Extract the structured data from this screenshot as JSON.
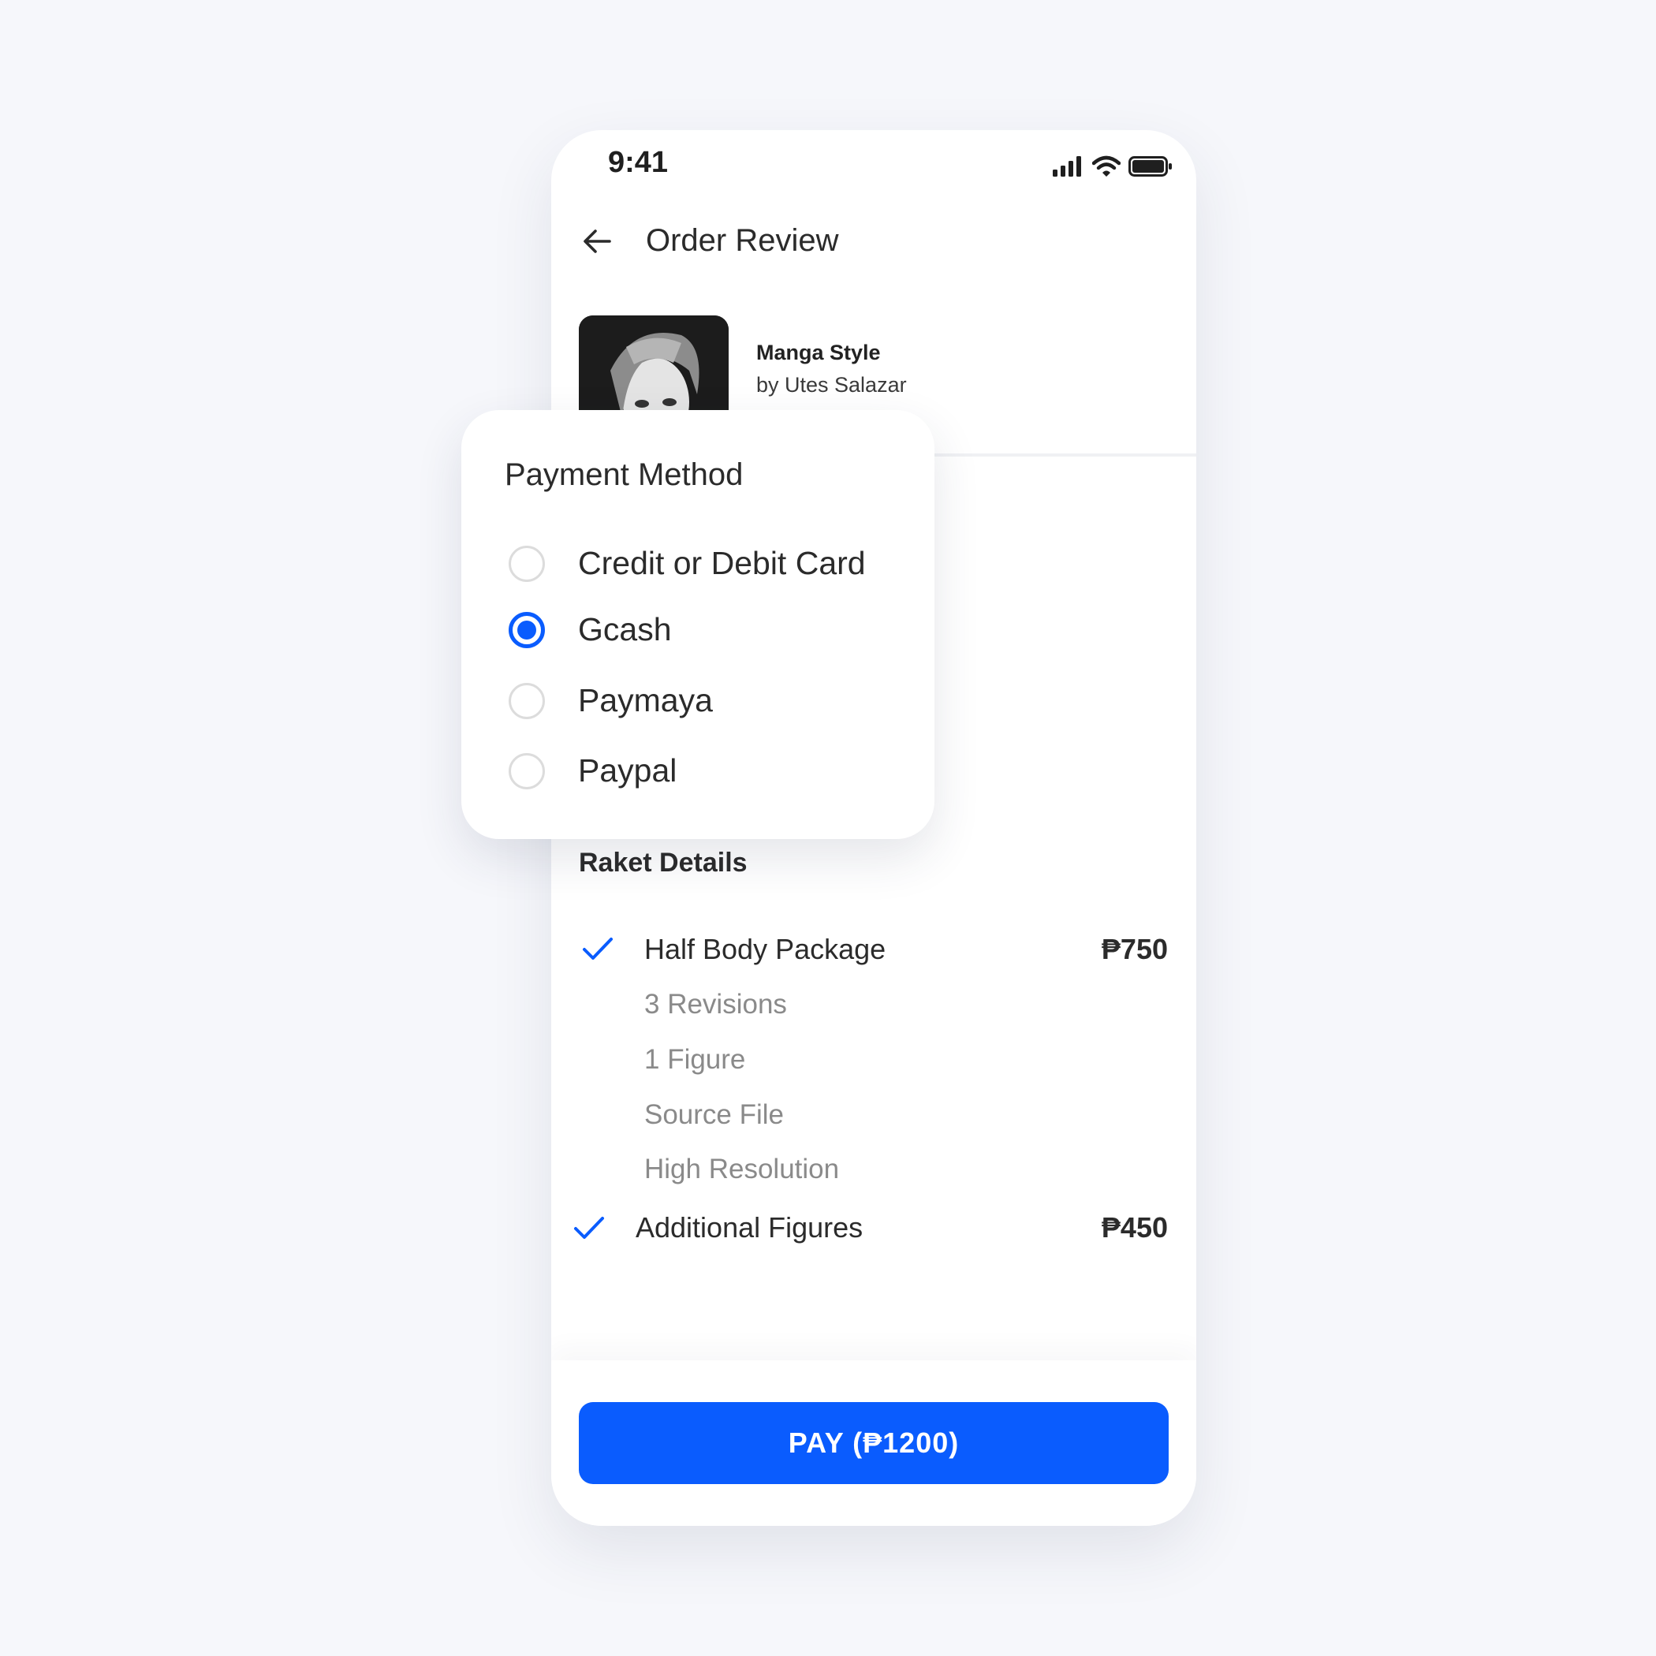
{
  "status_bar": {
    "time": "9:41"
  },
  "header": {
    "title": "Order Review"
  },
  "product": {
    "name": "Manga Style",
    "artist": "by Utes Salazar"
  },
  "payment": {
    "title": "Payment Method",
    "options": [
      {
        "label": "Credit or Debit Card",
        "selected": false
      },
      {
        "label": "Gcash",
        "selected": true
      },
      {
        "label": "Paymaya",
        "selected": false
      },
      {
        "label": "Paypal",
        "selected": false
      }
    ]
  },
  "details": {
    "title": "Raket Details",
    "package": {
      "label": "Half Body Package",
      "price": "₱750",
      "features": [
        "3 Revisions",
        "1 Figure",
        "Source File",
        "High Resolution"
      ]
    },
    "addon": {
      "label": "Additional Figures",
      "price": "₱450"
    }
  },
  "pay_button": {
    "label": "PAY (₱1200)"
  },
  "colors": {
    "accent": "#0a5cfe",
    "background": "#f6f7fb",
    "muted_text": "#8a8a8a"
  }
}
